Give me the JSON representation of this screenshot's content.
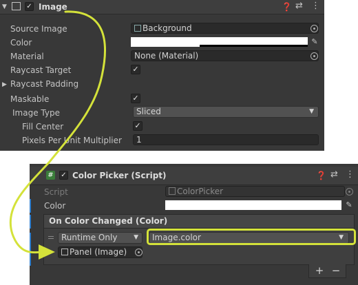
{
  "image_component": {
    "title": "Image",
    "rows": {
      "source_image_label": "Source Image",
      "source_image_value": "Background",
      "color_label": "Color",
      "material_label": "Material",
      "material_value": "None (Material)",
      "raycast_target_label": "Raycast Target",
      "raycast_padding_label": "Raycast Padding",
      "maskable_label": "Maskable",
      "image_type_label": "Image Type",
      "image_type_value": "Sliced",
      "fill_center_label": "Fill Center",
      "ppu_label": "Pixels Per Unit Multiplier",
      "ppu_value": "1"
    }
  },
  "color_picker_component": {
    "title": "Color Picker (Script)",
    "script_label": "Script",
    "script_value": "ColorPicker",
    "color_label": "Color",
    "event_header": "On Color Changed (Color)",
    "runtime_value": "Runtime Only",
    "function_value": "Image.color",
    "object_value": "Panel (Image)",
    "add_label": "+",
    "remove_label": "−"
  },
  "annotation": {
    "color": "#d4e23a"
  }
}
